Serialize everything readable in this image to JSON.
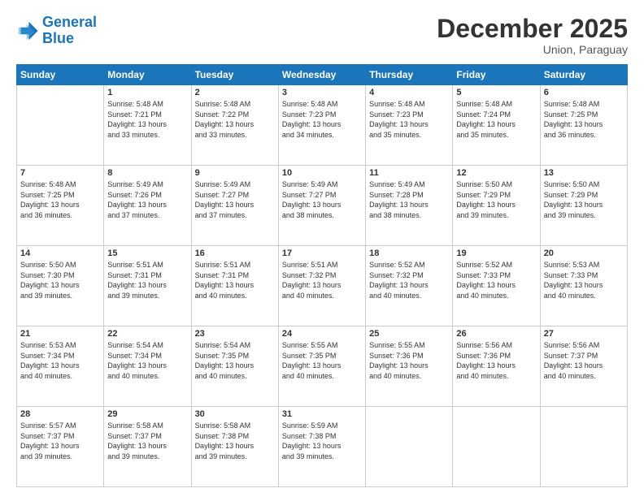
{
  "header": {
    "logo_line1": "General",
    "logo_line2": "Blue",
    "title": "December 2025",
    "subtitle": "Union, Paraguay"
  },
  "days_of_week": [
    "Sunday",
    "Monday",
    "Tuesday",
    "Wednesday",
    "Thursday",
    "Friday",
    "Saturday"
  ],
  "weeks": [
    [
      {
        "day": "",
        "info": ""
      },
      {
        "day": "1",
        "info": "Sunrise: 5:48 AM\nSunset: 7:21 PM\nDaylight: 13 hours\nand 33 minutes."
      },
      {
        "day": "2",
        "info": "Sunrise: 5:48 AM\nSunset: 7:22 PM\nDaylight: 13 hours\nand 33 minutes."
      },
      {
        "day": "3",
        "info": "Sunrise: 5:48 AM\nSunset: 7:23 PM\nDaylight: 13 hours\nand 34 minutes."
      },
      {
        "day": "4",
        "info": "Sunrise: 5:48 AM\nSunset: 7:23 PM\nDaylight: 13 hours\nand 35 minutes."
      },
      {
        "day": "5",
        "info": "Sunrise: 5:48 AM\nSunset: 7:24 PM\nDaylight: 13 hours\nand 35 minutes."
      },
      {
        "day": "6",
        "info": "Sunrise: 5:48 AM\nSunset: 7:25 PM\nDaylight: 13 hours\nand 36 minutes."
      }
    ],
    [
      {
        "day": "7",
        "info": "Sunrise: 5:48 AM\nSunset: 7:25 PM\nDaylight: 13 hours\nand 36 minutes."
      },
      {
        "day": "8",
        "info": "Sunrise: 5:49 AM\nSunset: 7:26 PM\nDaylight: 13 hours\nand 37 minutes."
      },
      {
        "day": "9",
        "info": "Sunrise: 5:49 AM\nSunset: 7:27 PM\nDaylight: 13 hours\nand 37 minutes."
      },
      {
        "day": "10",
        "info": "Sunrise: 5:49 AM\nSunset: 7:27 PM\nDaylight: 13 hours\nand 38 minutes."
      },
      {
        "day": "11",
        "info": "Sunrise: 5:49 AM\nSunset: 7:28 PM\nDaylight: 13 hours\nand 38 minutes."
      },
      {
        "day": "12",
        "info": "Sunrise: 5:50 AM\nSunset: 7:29 PM\nDaylight: 13 hours\nand 39 minutes."
      },
      {
        "day": "13",
        "info": "Sunrise: 5:50 AM\nSunset: 7:29 PM\nDaylight: 13 hours\nand 39 minutes."
      }
    ],
    [
      {
        "day": "14",
        "info": "Sunrise: 5:50 AM\nSunset: 7:30 PM\nDaylight: 13 hours\nand 39 minutes."
      },
      {
        "day": "15",
        "info": "Sunrise: 5:51 AM\nSunset: 7:31 PM\nDaylight: 13 hours\nand 39 minutes."
      },
      {
        "day": "16",
        "info": "Sunrise: 5:51 AM\nSunset: 7:31 PM\nDaylight: 13 hours\nand 40 minutes."
      },
      {
        "day": "17",
        "info": "Sunrise: 5:51 AM\nSunset: 7:32 PM\nDaylight: 13 hours\nand 40 minutes."
      },
      {
        "day": "18",
        "info": "Sunrise: 5:52 AM\nSunset: 7:32 PM\nDaylight: 13 hours\nand 40 minutes."
      },
      {
        "day": "19",
        "info": "Sunrise: 5:52 AM\nSunset: 7:33 PM\nDaylight: 13 hours\nand 40 minutes."
      },
      {
        "day": "20",
        "info": "Sunrise: 5:53 AM\nSunset: 7:33 PM\nDaylight: 13 hours\nand 40 minutes."
      }
    ],
    [
      {
        "day": "21",
        "info": "Sunrise: 5:53 AM\nSunset: 7:34 PM\nDaylight: 13 hours\nand 40 minutes."
      },
      {
        "day": "22",
        "info": "Sunrise: 5:54 AM\nSunset: 7:34 PM\nDaylight: 13 hours\nand 40 minutes."
      },
      {
        "day": "23",
        "info": "Sunrise: 5:54 AM\nSunset: 7:35 PM\nDaylight: 13 hours\nand 40 minutes."
      },
      {
        "day": "24",
        "info": "Sunrise: 5:55 AM\nSunset: 7:35 PM\nDaylight: 13 hours\nand 40 minutes."
      },
      {
        "day": "25",
        "info": "Sunrise: 5:55 AM\nSunset: 7:36 PM\nDaylight: 13 hours\nand 40 minutes."
      },
      {
        "day": "26",
        "info": "Sunrise: 5:56 AM\nSunset: 7:36 PM\nDaylight: 13 hours\nand 40 minutes."
      },
      {
        "day": "27",
        "info": "Sunrise: 5:56 AM\nSunset: 7:37 PM\nDaylight: 13 hours\nand 40 minutes."
      }
    ],
    [
      {
        "day": "28",
        "info": "Sunrise: 5:57 AM\nSunset: 7:37 PM\nDaylight: 13 hours\nand 39 minutes."
      },
      {
        "day": "29",
        "info": "Sunrise: 5:58 AM\nSunset: 7:37 PM\nDaylight: 13 hours\nand 39 minutes."
      },
      {
        "day": "30",
        "info": "Sunrise: 5:58 AM\nSunset: 7:38 PM\nDaylight: 13 hours\nand 39 minutes."
      },
      {
        "day": "31",
        "info": "Sunrise: 5:59 AM\nSunset: 7:38 PM\nDaylight: 13 hours\nand 39 minutes."
      },
      {
        "day": "",
        "info": ""
      },
      {
        "day": "",
        "info": ""
      },
      {
        "day": "",
        "info": ""
      }
    ]
  ]
}
